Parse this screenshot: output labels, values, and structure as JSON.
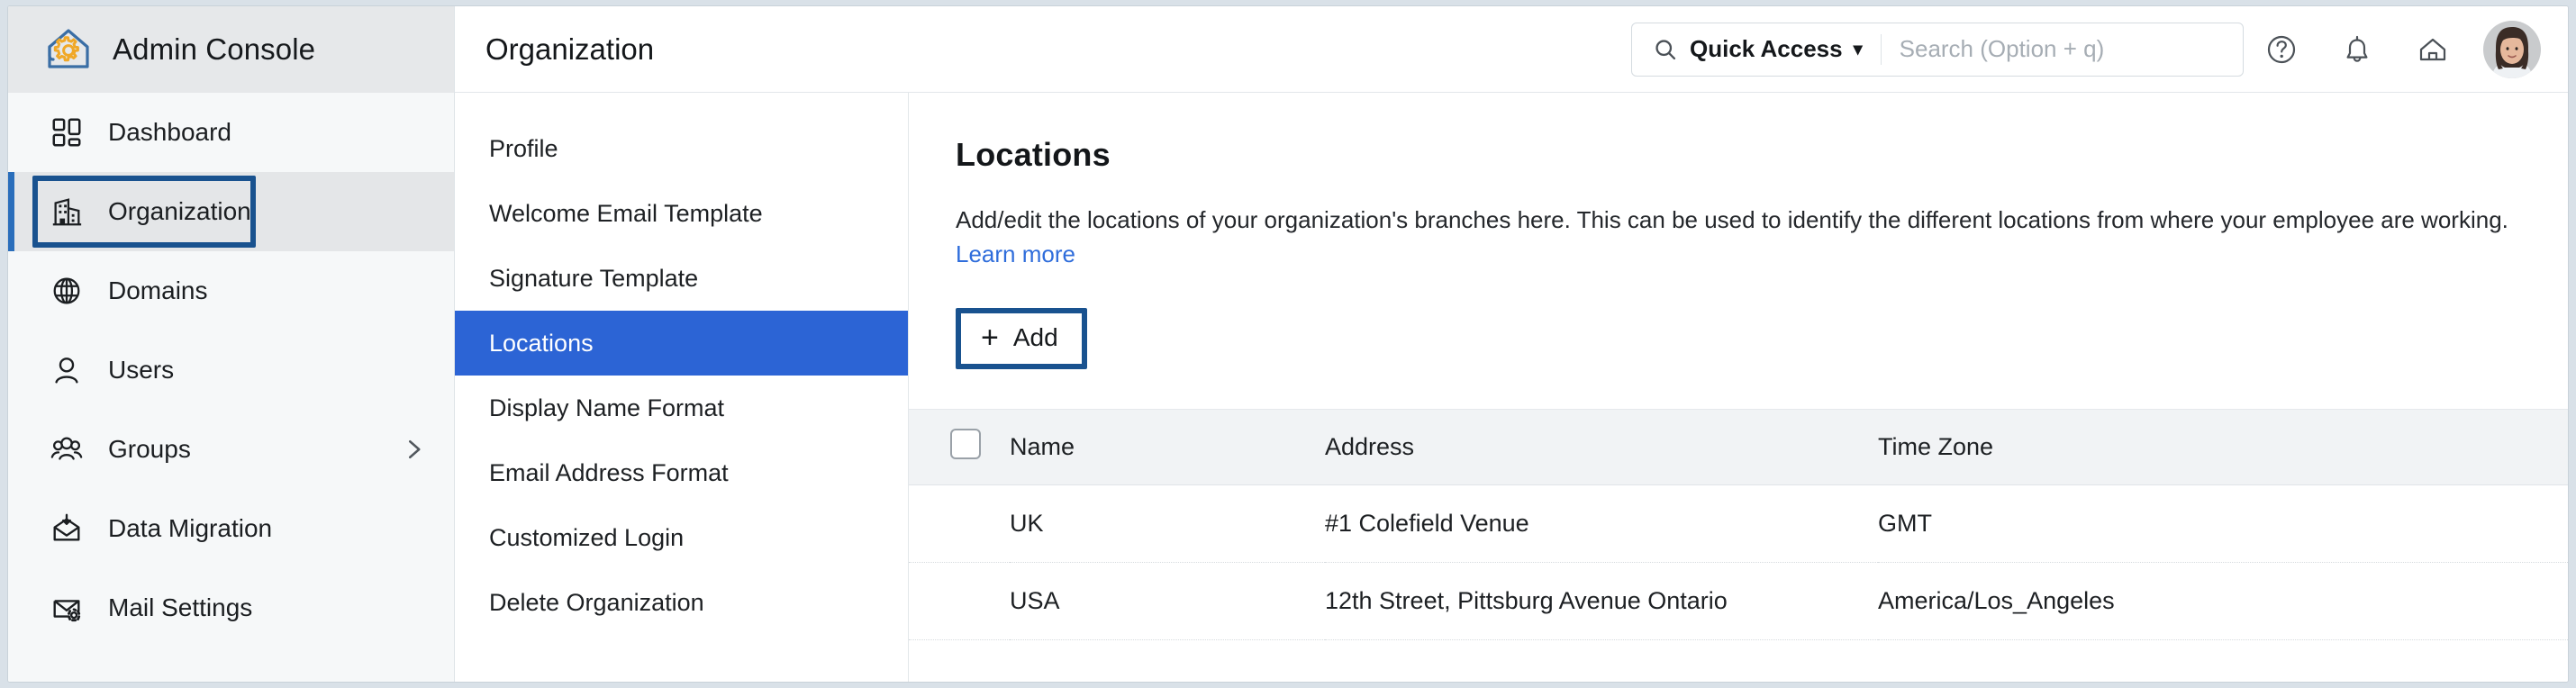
{
  "brand": {
    "title": "Admin Console",
    "logo_icon": "house-gear-logo",
    "logo_color_outline": "#3a6ea5",
    "logo_color_gear": "#f0a828"
  },
  "sidebar": {
    "items": [
      {
        "label": "Dashboard",
        "icon": "dashboard-grid-icon",
        "active": false,
        "has_chevron": false
      },
      {
        "label": "Organization",
        "icon": "building-icon",
        "active": true,
        "has_chevron": false
      },
      {
        "label": "Domains",
        "icon": "globe-icon",
        "active": false,
        "has_chevron": false
      },
      {
        "label": "Users",
        "icon": "user-icon",
        "active": false,
        "has_chevron": false
      },
      {
        "label": "Groups",
        "icon": "groups-icon",
        "active": false,
        "has_chevron": true
      },
      {
        "label": "Data Migration",
        "icon": "mail-download-icon",
        "active": false,
        "has_chevron": false
      },
      {
        "label": "Mail Settings",
        "icon": "mail-gear-icon",
        "active": false,
        "has_chevron": false
      }
    ],
    "active_accent": "#2a6ebb",
    "focus_ring_color": "#19528f"
  },
  "header": {
    "page_title": "Organization",
    "search": {
      "scope_label": "Quick Access",
      "scope_caret": "▾",
      "search_icon": "search-icon",
      "placeholder": "Search (Option + q)",
      "value": ""
    },
    "icons": [
      {
        "name": "help-icon",
        "glyph": "?"
      },
      {
        "name": "notifications-bell-icon",
        "glyph": "bell"
      },
      {
        "name": "home-icon",
        "glyph": "home"
      }
    ],
    "avatar": "user-avatar"
  },
  "subnav": {
    "items": [
      {
        "label": "Profile",
        "active": false
      },
      {
        "label": "Welcome Email Template",
        "active": false
      },
      {
        "label": "Signature Template",
        "active": false
      },
      {
        "label": "Locations",
        "active": true
      },
      {
        "label": "Display Name Format",
        "active": false
      },
      {
        "label": "Email Address Format",
        "active": false
      },
      {
        "label": "Customized Login",
        "active": false
      },
      {
        "label": "Delete Organization",
        "active": false
      }
    ],
    "active_color": "#2c64d5"
  },
  "main": {
    "title": "Locations",
    "description": "Add/edit the locations of your organization's branches here. This can be used to identify the different locations from where your employee are working.",
    "learn_more_label": "Learn more",
    "add_button": {
      "plus": "+",
      "label": "Add"
    },
    "table": {
      "select_all_checked": false,
      "columns": [
        "Name",
        "Address",
        "Time Zone"
      ],
      "rows": [
        {
          "name": "UK",
          "address": "#1 Colefield Venue",
          "timezone": "GMT"
        },
        {
          "name": "USA",
          "address": "12th Street, Pittsburg Avenue Ontario",
          "timezone": "America/Los_Angeles"
        }
      ]
    }
  }
}
